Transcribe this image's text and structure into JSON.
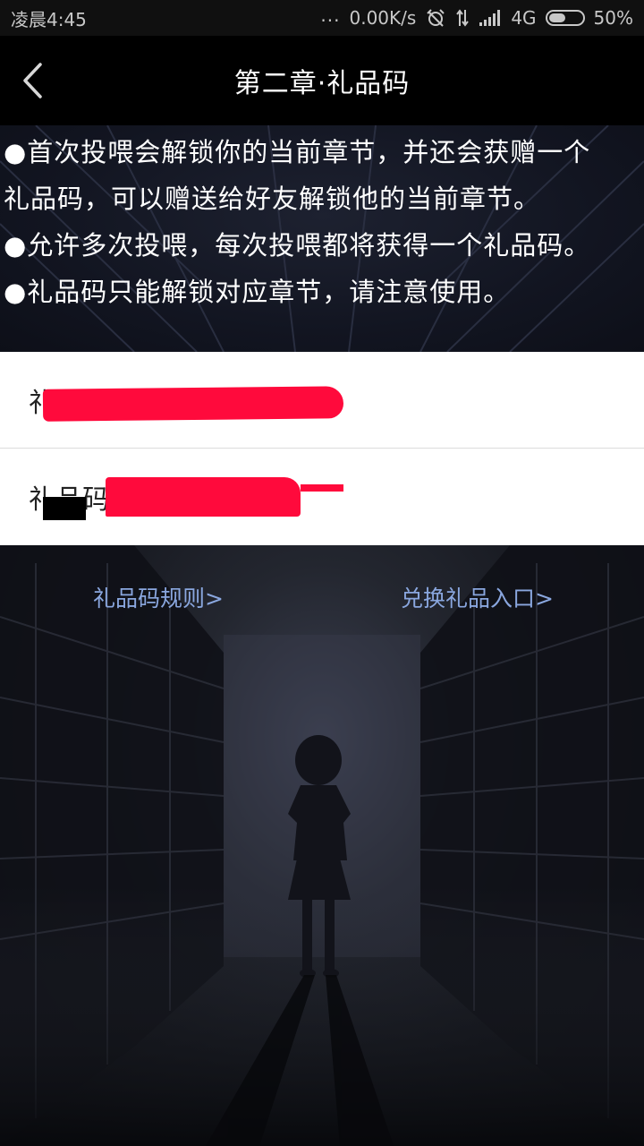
{
  "status_bar": {
    "time": "凌晨4:45",
    "more": "...",
    "network_speed": "0.00K/s",
    "signal_type": "4G",
    "battery": "50%",
    "battery_level": 0.5
  },
  "nav": {
    "title": "第二章·礼品码",
    "back_icon": "chevron-left-icon"
  },
  "description": {
    "lines": [
      "●首次投喂会解锁你的当前章节，并还会获赠一个",
      "礼品码，可以赠送给好友解锁他的当前章节。",
      "●允许多次投喂，每次投喂都将获得一个礼品码。",
      "●礼品码只能解锁对应章节，请注意使用。"
    ]
  },
  "gift_codes": [
    {
      "label": "礼品码"
    },
    {
      "label": "礼品码"
    }
  ],
  "links": {
    "rules": "礼品码规则>",
    "redeem": "兑换礼品入口>"
  },
  "colors": {
    "nav_bg": "#000000",
    "link": "#8aa7df",
    "redaction": "#ff0a3c"
  }
}
